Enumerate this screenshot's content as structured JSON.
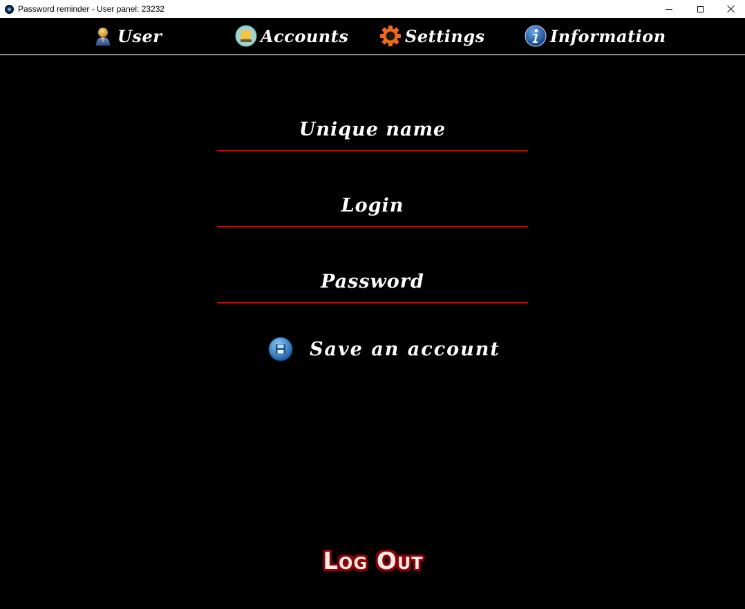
{
  "window": {
    "title": "Password reminder - User panel: 23232"
  },
  "nav": {
    "items": [
      {
        "label": "User",
        "icon": "user-icon"
      },
      {
        "label": "Accounts",
        "icon": "book-icon"
      },
      {
        "label": "Settings",
        "icon": "gear-icon"
      },
      {
        "label": "Information",
        "icon": "info-icon"
      }
    ]
  },
  "form": {
    "unique_name_placeholder": "Unique name",
    "login_placeholder": "Login",
    "password_placeholder": "Password",
    "unique_name_value": "",
    "login_value": "",
    "password_value": "",
    "save_label": "Save an account",
    "save_icon": "save-icon"
  },
  "logout": {
    "label": "Log Out"
  },
  "colors": {
    "background": "#000000",
    "accent_underline": "#e00000",
    "logout_outline": "#8b0000",
    "nav_divider": "#8a8a8a"
  }
}
